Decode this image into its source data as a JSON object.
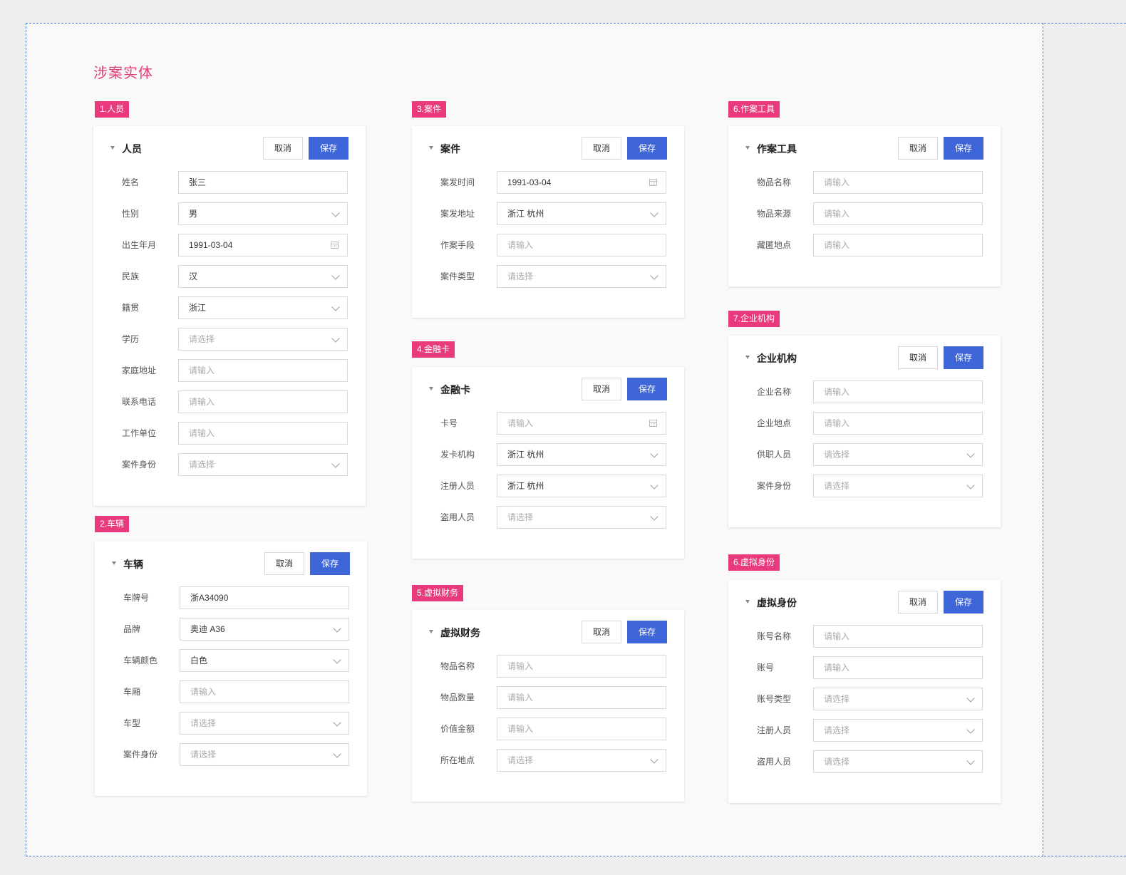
{
  "page_title": "涉案实体",
  "buttons": {
    "cancel": "取消",
    "save": "保存"
  },
  "sections": [
    {
      "tag": "1.人员",
      "title": "人员",
      "fields": [
        {
          "label": "姓名",
          "value": "张三",
          "kind": "input",
          "placeholder": false
        },
        {
          "label": "性别",
          "value": "男",
          "kind": "select",
          "placeholder": false
        },
        {
          "label": "出生年月",
          "value": "1991-03-04",
          "kind": "date",
          "placeholder": false
        },
        {
          "label": "民族",
          "value": "汉",
          "kind": "select",
          "placeholder": false
        },
        {
          "label": "籍贯",
          "value": "浙江",
          "kind": "select",
          "placeholder": false
        },
        {
          "label": "学历",
          "value": "请选择",
          "kind": "select",
          "placeholder": true
        },
        {
          "label": "家庭地址",
          "value": "请输入",
          "kind": "input",
          "placeholder": true
        },
        {
          "label": "联系电话",
          "value": "请输入",
          "kind": "input",
          "placeholder": true
        },
        {
          "label": "工作单位",
          "value": "请输入",
          "kind": "input",
          "placeholder": true
        },
        {
          "label": "案件身份",
          "value": "请选择",
          "kind": "select",
          "placeholder": true
        }
      ]
    },
    {
      "tag": "2.车辆",
      "title": "车辆",
      "fields": [
        {
          "label": "车牌号",
          "value": "浙A34090",
          "kind": "input",
          "placeholder": false
        },
        {
          "label": "品牌",
          "value": "奥迪 A36",
          "kind": "select",
          "placeholder": false
        },
        {
          "label": "车辆颜色",
          "value": "白色",
          "kind": "select",
          "placeholder": false
        },
        {
          "label": "车厢",
          "value": "请输入",
          "kind": "input",
          "placeholder": true
        },
        {
          "label": "车型",
          "value": "请选择",
          "kind": "select",
          "placeholder": true
        },
        {
          "label": "案件身份",
          "value": "请选择",
          "kind": "select",
          "placeholder": true
        }
      ]
    },
    {
      "tag": "3.案件",
      "title": "案件",
      "fields": [
        {
          "label": "案发时间",
          "value": "1991-03-04",
          "kind": "date",
          "placeholder": false
        },
        {
          "label": "案发地址",
          "value": "浙江 杭州",
          "kind": "select",
          "placeholder": false
        },
        {
          "label": "作案手段",
          "value": "请输入",
          "kind": "input",
          "placeholder": true
        },
        {
          "label": "案件类型",
          "value": "请选择",
          "kind": "select",
          "placeholder": true
        }
      ]
    },
    {
      "tag": "4.金融卡",
      "title": "金融卡",
      "fields": [
        {
          "label": "卡号",
          "value": "请输入",
          "kind": "date",
          "placeholder": true
        },
        {
          "label": "发卡机构",
          "value": "浙江 杭州",
          "kind": "select",
          "placeholder": false
        },
        {
          "label": "注册人员",
          "value": "浙江 杭州",
          "kind": "select",
          "placeholder": false
        },
        {
          "label": "盗用人员",
          "value": "请选择",
          "kind": "select",
          "placeholder": true
        }
      ]
    },
    {
      "tag": "5.虚拟财务",
      "title": "虚拟财务",
      "fields": [
        {
          "label": "物品名称",
          "value": "请输入",
          "kind": "input",
          "placeholder": true
        },
        {
          "label": "物品数量",
          "value": "请输入",
          "kind": "input",
          "placeholder": true
        },
        {
          "label": "价值金额",
          "value": "请输入",
          "kind": "input",
          "placeholder": true
        },
        {
          "label": "所在地点",
          "value": "请选择",
          "kind": "select",
          "placeholder": true
        }
      ]
    },
    {
      "tag": "6.作案工具",
      "title": "作案工具",
      "fields": [
        {
          "label": "物品名称",
          "value": "请输入",
          "kind": "input",
          "placeholder": true
        },
        {
          "label": "物品来源",
          "value": "请输入",
          "kind": "input",
          "placeholder": true
        },
        {
          "label": "藏匿地点",
          "value": "请输入",
          "kind": "input",
          "placeholder": true
        }
      ]
    },
    {
      "tag": "7.企业机构",
      "title": "企业机构",
      "fields": [
        {
          "label": "企业名称",
          "value": "请输入",
          "kind": "input",
          "placeholder": true
        },
        {
          "label": "企业地点",
          "value": "请输入",
          "kind": "input",
          "placeholder": true
        },
        {
          "label": "供职人员",
          "value": "请选择",
          "kind": "select",
          "placeholder": true
        },
        {
          "label": "案件身份",
          "value": "请选择",
          "kind": "select",
          "placeholder": true
        }
      ]
    },
    {
      "tag": "6.虚拟身份",
      "title": "虚拟身份",
      "fields": [
        {
          "label": "账号名称",
          "value": "请输入",
          "kind": "input",
          "placeholder": true
        },
        {
          "label": "账号",
          "value": "请输入",
          "kind": "input",
          "placeholder": true
        },
        {
          "label": "账号类型",
          "value": "请选择",
          "kind": "select",
          "placeholder": true
        },
        {
          "label": "注册人员",
          "value": "请选择",
          "kind": "select",
          "placeholder": true
        },
        {
          "label": "盗用人员",
          "value": "请选择",
          "kind": "select",
          "placeholder": true
        }
      ]
    }
  ]
}
